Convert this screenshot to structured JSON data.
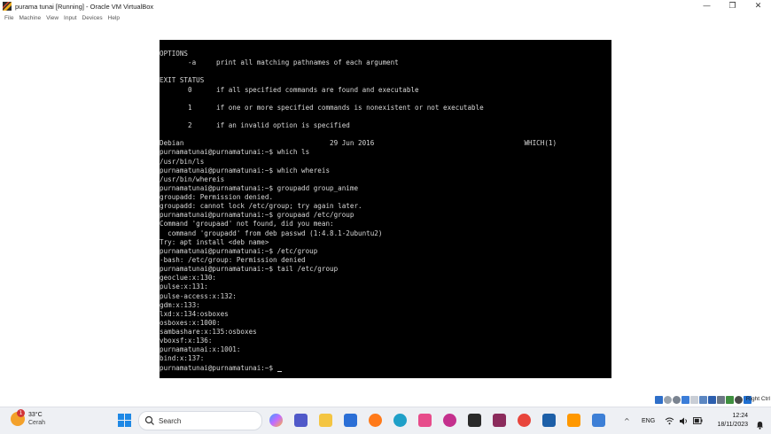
{
  "window": {
    "title": "purama tunai [Running] - Oracle VM VirtualBox",
    "minimize": "—",
    "maximize": "❐",
    "close": "✕"
  },
  "menu": [
    "File",
    "Machine",
    "View",
    "Input",
    "Devices",
    "Help"
  ],
  "terminal": {
    "lines": [
      "OPTIONS",
      "       -a     print all matching pathnames of each argument",
      "",
      "EXIT STATUS",
      "       0      if all specified commands are found and executable",
      "",
      "       1      if one or more specified commands is nonexistent or not executable",
      "",
      "       2      if an invalid option is specified",
      "",
      "Debian                                    29 Jun 2016                                     WHICH(1)",
      "purnamatunai@purnamatunai:~$ which ls",
      "/usr/bin/ls",
      "purnamatunai@purnamatunai:~$ which whereis",
      "/usr/bin/whereis",
      "purnamatunai@purnamatunai:~$ groupadd group_anime",
      "groupadd: Permission denied.",
      "groupadd: cannot lock /etc/group; try again later.",
      "purnamatunai@purnamatunai:~$ groupaad /etc/group",
      "Command 'groupaad' not found, did you mean:",
      "  command 'groupadd' from deb passwd (1:4.8.1-2ubuntu2)",
      "Try: apt install <deb name>",
      "purnamatunai@purnamatunai:~$ /etc/group",
      "-bash: /etc/group: Permission denied",
      "purnamatunai@purnamatunai:~$ tail /etc/group",
      "geoclue:x:130:",
      "pulse:x:131:",
      "pulse-access:x:132:",
      "gdm:x:133:",
      "lxd:x:134:osboxes",
      "osboxes:x:1000:",
      "sambashare:x:135:osboxes",
      "vboxsf:x:136:",
      "purnamatunai:x:1001:",
      "bind:x:137:"
    ],
    "prompt": "purnamatunai@purnamatunai:~$ ",
    "text_color": "#d8d8d8",
    "background": "#000000"
  },
  "statusbar": {
    "host_key": "Right Ctrl",
    "icons": [
      "hard-disk-icon",
      "optical-drive-icon",
      "audio-icon",
      "network-icon",
      "usb-icon",
      "shared-folder-icon",
      "display-icon",
      "recording-icon",
      "cpu-icon",
      "mouse-integration-icon",
      "keyboard-icon"
    ]
  },
  "taskbar": {
    "weather": {
      "temp": "33°C",
      "condition": "Cerah",
      "badge": "1"
    },
    "search_placeholder": "Search",
    "apps": [
      "copilot-icon",
      "teams-icon",
      "file-explorer-icon",
      "store-icon",
      "firefox-icon",
      "edge-icon",
      "snipping-tool-icon",
      "wps-icon",
      "terminal-icon",
      "winrar-icon",
      "chrome-icon",
      "virtualbox-icon",
      "sublime-icon",
      "unknown-app-icon"
    ],
    "language": "ENG",
    "time": "12:24",
    "date": "18/11/2023",
    "accent": "#1e88e5"
  }
}
